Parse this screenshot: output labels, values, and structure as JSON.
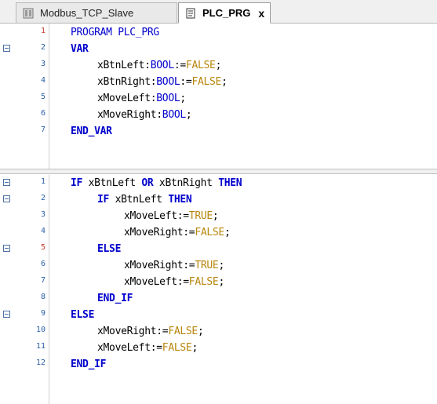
{
  "tabs": [
    {
      "label": "Modbus_TCP_Slave",
      "active": false
    },
    {
      "label": "PLC_PRG",
      "active": true,
      "close": "x"
    }
  ],
  "declaration": {
    "line_numbers": [
      "1",
      "2",
      "3",
      "4",
      "5",
      "6",
      "7"
    ],
    "lines": [
      {
        "parts": [
          {
            "t": "PROGRAM PLC_PRG",
            "c": "kw-plain"
          }
        ]
      },
      {
        "parts": [
          {
            "t": "VAR",
            "c": "kw"
          }
        ]
      },
      {
        "parts": [
          {
            "t": "xBtnLeft:"
          },
          {
            "t": "BOOL",
            "c": "ty"
          },
          {
            "t": ":="
          },
          {
            "t": "FALSE",
            "c": "lit"
          },
          {
            "t": ";"
          }
        ]
      },
      {
        "parts": [
          {
            "t": "xBtnRight:"
          },
          {
            "t": "BOOL",
            "c": "ty"
          },
          {
            "t": ":="
          },
          {
            "t": "FALSE",
            "c": "lit"
          },
          {
            "t": ";"
          }
        ]
      },
      {
        "parts": [
          {
            "t": "xMoveLeft:"
          },
          {
            "t": "BOOL",
            "c": "ty"
          },
          {
            "t": ";"
          }
        ]
      },
      {
        "parts": [
          {
            "t": "xMoveRight:"
          },
          {
            "t": "BOOL",
            "c": "ty"
          },
          {
            "t": ";"
          }
        ]
      },
      {
        "parts": [
          {
            "t": "END_VAR",
            "c": "kw"
          }
        ]
      }
    ]
  },
  "implementation": {
    "line_numbers": [
      "1",
      "2",
      "3",
      "4",
      "5",
      "6",
      "7",
      "8",
      "9",
      "10",
      "11",
      "12"
    ],
    "lines": [
      {
        "parts": [
          {
            "t": "IF",
            "c": "kw"
          },
          {
            "t": " xBtnLeft "
          },
          {
            "t": "OR",
            "c": "kw"
          },
          {
            "t": " xBtnRight "
          },
          {
            "t": "THEN",
            "c": "kw"
          }
        ]
      },
      {
        "parts": [
          {
            "t": "IF",
            "c": "kw"
          },
          {
            "t": " xBtnLeft "
          },
          {
            "t": "THEN",
            "c": "kw"
          }
        ]
      },
      {
        "parts": [
          {
            "t": "xMoveLeft:="
          },
          {
            "t": "TRUE",
            "c": "lit"
          },
          {
            "t": ";"
          }
        ]
      },
      {
        "parts": [
          {
            "t": "xMoveRight:="
          },
          {
            "t": "FALSE",
            "c": "lit"
          },
          {
            "t": ";"
          }
        ]
      },
      {
        "parts": [
          {
            "t": "ELSE",
            "c": "kw"
          }
        ]
      },
      {
        "parts": [
          {
            "t": "xMoveRight:="
          },
          {
            "t": "TRUE",
            "c": "lit"
          },
          {
            "t": ";"
          }
        ]
      },
      {
        "parts": [
          {
            "t": "xMoveLeft:="
          },
          {
            "t": "FALSE",
            "c": "lit"
          },
          {
            "t": ";"
          }
        ]
      },
      {
        "parts": [
          {
            "t": "END_IF",
            "c": "kw"
          }
        ]
      },
      {
        "parts": [
          {
            "t": "ELSE",
            "c": "kw"
          }
        ]
      },
      {
        "parts": [
          {
            "t": "xMoveRight:="
          },
          {
            "t": "FALSE",
            "c": "lit"
          },
          {
            "t": ";"
          }
        ]
      },
      {
        "parts": [
          {
            "t": "xMoveLeft:="
          },
          {
            "t": "FALSE",
            "c": "lit"
          },
          {
            "t": ";"
          }
        ]
      },
      {
        "parts": [
          {
            "t": "END_IF",
            "c": "kw"
          }
        ]
      }
    ]
  },
  "colors": {
    "keyword": "#0000cc",
    "literal": "#b8860b",
    "line_number": "#2b5fa7"
  }
}
